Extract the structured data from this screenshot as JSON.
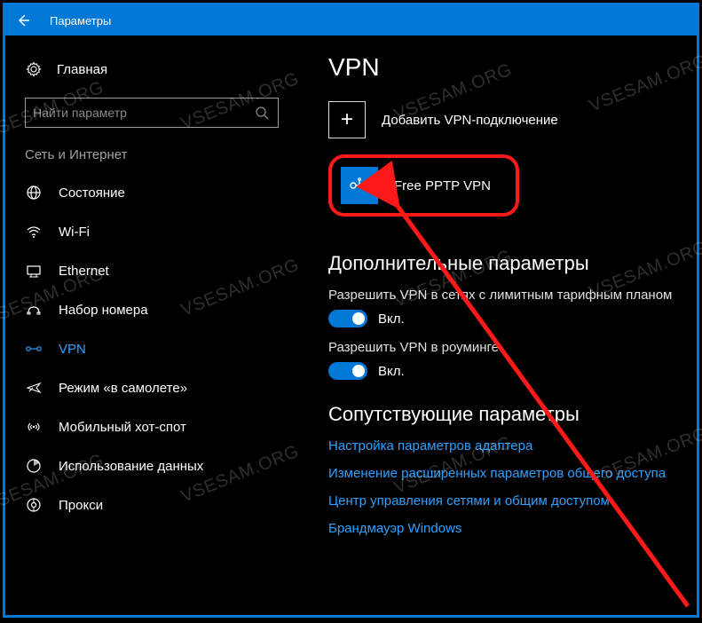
{
  "titlebar": {
    "title": "Параметры"
  },
  "sidebar": {
    "home": "Главная",
    "search_placeholder": "Найти параметр",
    "section": "Сеть и Интернет",
    "items": [
      {
        "label": "Состояние",
        "icon": "globe"
      },
      {
        "label": "Wi-Fi",
        "icon": "wifi"
      },
      {
        "label": "Ethernet",
        "icon": "ethernet"
      },
      {
        "label": "Набор номера",
        "icon": "dialup"
      },
      {
        "label": "VPN",
        "icon": "vpn",
        "active": true
      },
      {
        "label": "Режим «в самолете»",
        "icon": "airplane"
      },
      {
        "label": "Мобильный хот-спот",
        "icon": "hotspot"
      },
      {
        "label": "Использование данных",
        "icon": "data"
      },
      {
        "label": "Прокси",
        "icon": "proxy"
      }
    ]
  },
  "main": {
    "title": "VPN",
    "add_label": "Добавить VPN-подключение",
    "connection": {
      "name": "Free PPTP VPN"
    },
    "advanced_heading": "Дополнительные параметры",
    "settings": [
      {
        "label": "Разрешить VPN в сетях с лимитным тарифным планом",
        "state": "Вкл."
      },
      {
        "label": "Разрешить VPN в роуминге",
        "state": "Вкл."
      }
    ],
    "related_heading": "Сопутствующие параметры",
    "links": [
      "Настройка параметров адаптера",
      "Изменение расширенных параметров общего доступа",
      "Центр управления сетями и общим доступом",
      "Брандмауэр Windows"
    ]
  },
  "watermark_text": "VSESAM.ORG"
}
